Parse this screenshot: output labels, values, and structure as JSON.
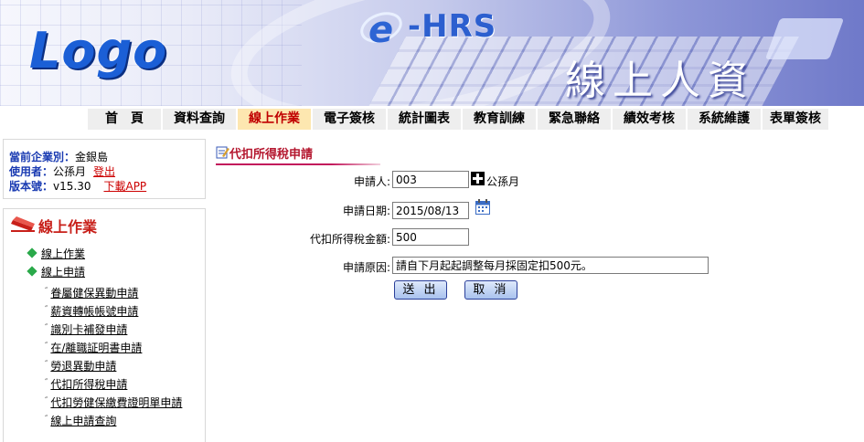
{
  "banner": {
    "logo": "Logo",
    "brand_e": "e",
    "brand_text": "-HRS",
    "subtitle": "線上人資"
  },
  "nav": {
    "items": [
      {
        "label": "首　頁",
        "active": false
      },
      {
        "label": "資料查詢",
        "active": false
      },
      {
        "label": "線上作業",
        "active": true
      },
      {
        "label": "電子簽核",
        "active": false
      },
      {
        "label": "統計圖表",
        "active": false
      },
      {
        "label": "教育訓練",
        "active": false
      },
      {
        "label": "緊急聯絡",
        "active": false
      },
      {
        "label": "績效考核",
        "active": false
      },
      {
        "label": "系統維護",
        "active": false
      },
      {
        "label": "表單簽核",
        "active": false
      }
    ]
  },
  "info": {
    "company_label": "當前企業別：",
    "company_value": "金銀島",
    "user_label": "使用者：",
    "user_value": "公孫月",
    "logout": "登出",
    "version_label": "版本號：",
    "version_value": "v15.30",
    "download": "下載APP"
  },
  "sidebar": {
    "title": "線上作業",
    "nodes": [
      "線上作業",
      "線上申請"
    ],
    "items": [
      "眷屬健保異動申請",
      "薪資轉帳帳號申請",
      "識別卡補發申請",
      "在/離職証明書申請",
      "勞退異動申請",
      "代扣所得稅申請",
      "代扣勞健保繳費證明單申請",
      "線上申請查詢"
    ]
  },
  "form": {
    "title": "代扣所得稅申請",
    "applicant_label": "申請人:",
    "applicant_value": "003",
    "applicant_name": "公孫月",
    "date_label": "申請日期:",
    "date_value": "2015/08/13",
    "amount_label": "代扣所得稅金額:",
    "amount_value": "500",
    "reason_label": "申請原因:",
    "reason_value": "請自下月起起調整每月採固定扣500元。",
    "submit": "送 出",
    "cancel": "取 消"
  },
  "colors": {
    "nav_active_bg": "#fde7b0",
    "nav_active_text": "#c00000",
    "sidebar_title": "#c8201a",
    "form_title": "#b4162e",
    "info_label": "#1a3bb2"
  }
}
